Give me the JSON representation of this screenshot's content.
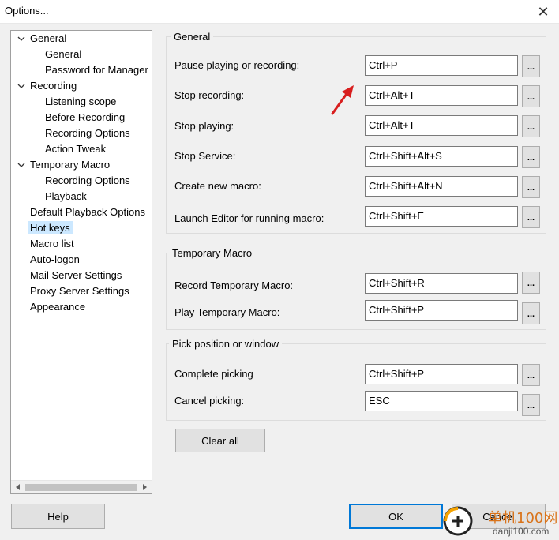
{
  "window": {
    "title": "Options...",
    "close_glyph": "✕"
  },
  "tree": {
    "items": [
      {
        "label": "General",
        "expanded": true
      },
      {
        "label": "General"
      },
      {
        "label": "Password for Manager"
      },
      {
        "label": "Recording",
        "expanded": true
      },
      {
        "label": "Listening scope"
      },
      {
        "label": "Before Recording"
      },
      {
        "label": "Recording Options"
      },
      {
        "label": "Action Tweak"
      },
      {
        "label": "Temporary Macro",
        "expanded": true
      },
      {
        "label": "Recording Options"
      },
      {
        "label": "Playback"
      },
      {
        "label": "Default Playback Options"
      },
      {
        "label": "Hot keys",
        "selected": true
      },
      {
        "label": "Macro list"
      },
      {
        "label": "Auto-logon"
      },
      {
        "label": "Mail Server Settings"
      },
      {
        "label": "Proxy Server Settings"
      },
      {
        "label": "Appearance"
      }
    ]
  },
  "groups": {
    "general": {
      "title": "General",
      "rows": [
        {
          "label": "Pause playing or recording:",
          "value": "Ctrl+P"
        },
        {
          "label": "Stop recording:",
          "value": "Ctrl+Alt+T"
        },
        {
          "label": "Stop playing:",
          "value": "Ctrl+Alt+T"
        },
        {
          "label": "Stop Service:",
          "value": "Ctrl+Shift+Alt+S"
        },
        {
          "label": "Create new macro:",
          "value": "Ctrl+Shift+Alt+N"
        },
        {
          "label": "Launch Editor for running macro:",
          "value": "Ctrl+Shift+E"
        }
      ]
    },
    "temporary": {
      "title": "Temporary Macro",
      "rows": [
        {
          "label": "Record Temporary Macro:",
          "value": "Ctrl+Shift+R"
        },
        {
          "label": "Play Temporary Macro:",
          "value": "Ctrl+Shift+P"
        }
      ]
    },
    "pick": {
      "title": "Pick position or window",
      "rows": [
        {
          "label": "Complete picking",
          "value": "Ctrl+Shift+P"
        },
        {
          "label": "Cancel picking:",
          "value": "ESC"
        }
      ]
    }
  },
  "dots_label": "...",
  "buttons": {
    "clear_all": "Clear all",
    "help": "Help",
    "ok": "OK",
    "cancel": "Cancel"
  },
  "watermark": {
    "text": "单机100网",
    "url": "danji100.com"
  },
  "colors": {
    "selection": "#cce8ff",
    "accent": "#0078d7",
    "arrow": "#e02020"
  }
}
